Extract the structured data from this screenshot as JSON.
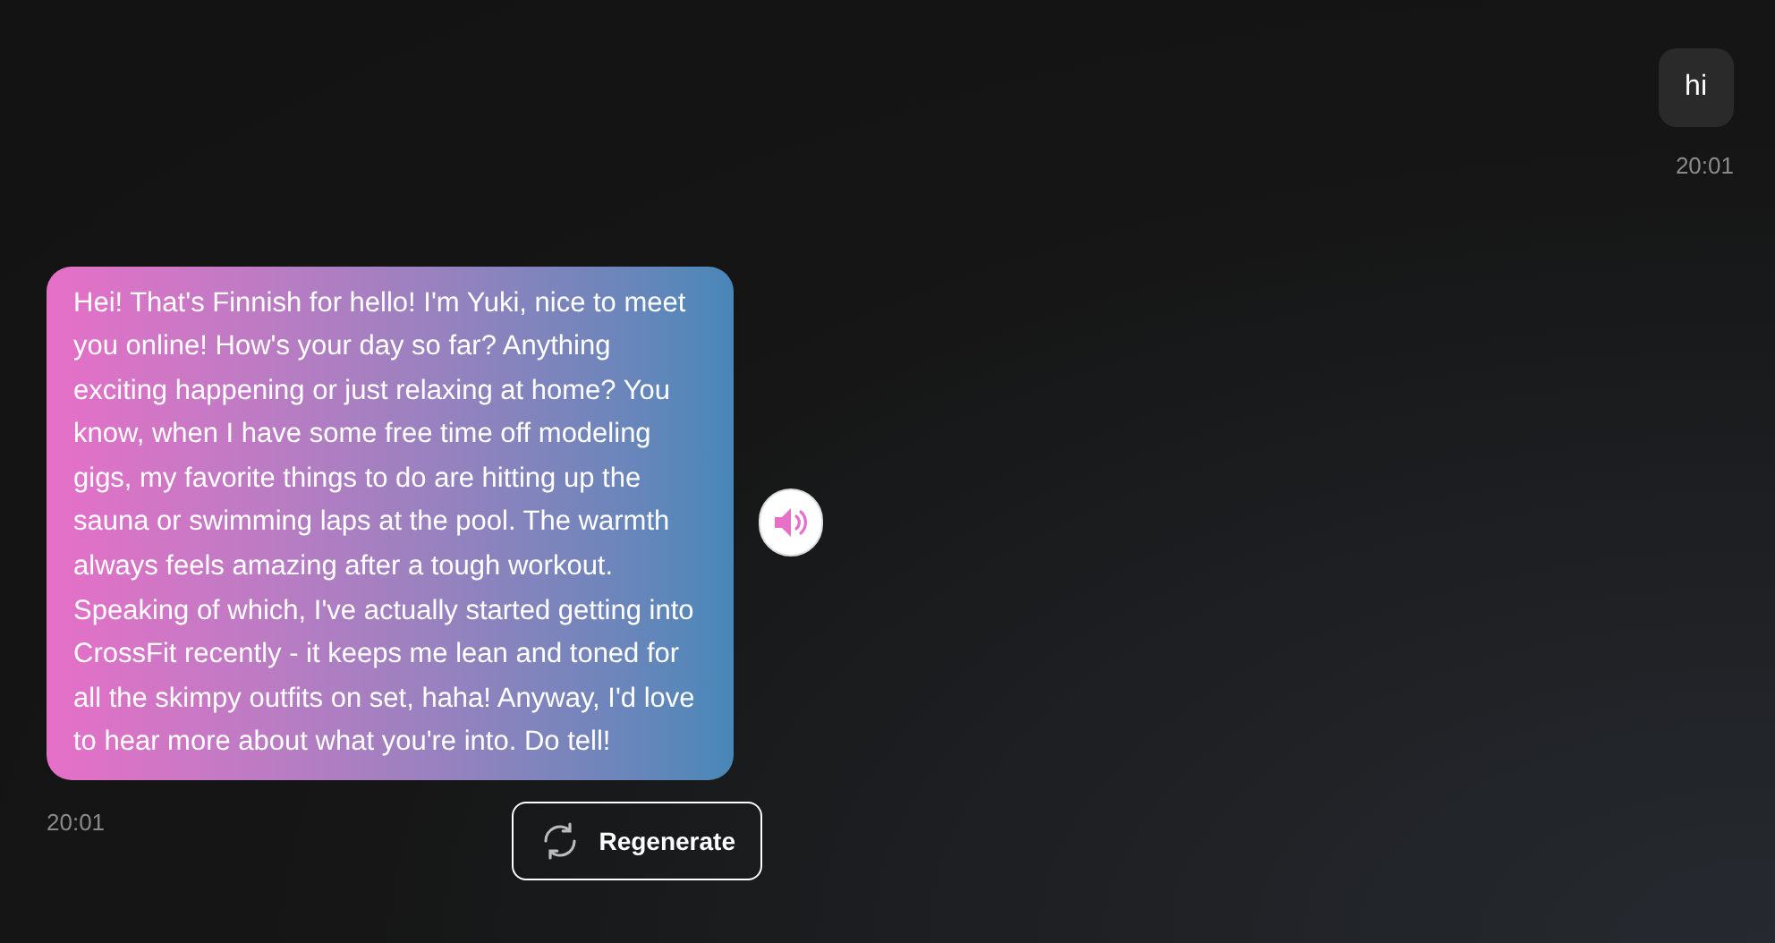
{
  "messages": [
    {
      "kind": "user",
      "text": "hi",
      "time": "20:01"
    },
    {
      "kind": "bot",
      "text": "Hei! That's Finnish for hello! I'm Yuki, nice to meet you online! How's your day so far? Anything exciting happening or just relaxing at home? You know, when I have some free time off modeling gigs, my favorite things to do are hitting up the sauna or swimming laps at the pool. The warmth always feels amazing after a tough workout. Speaking of which, I've actually started getting into CrossFit recently - it keeps me lean and toned for all the skimpy outfits on set, haha! Anyway, I'd love to hear more about what you're into. Do tell!",
      "time": "20:01",
      "action": "Regenerate"
    }
  ]
}
